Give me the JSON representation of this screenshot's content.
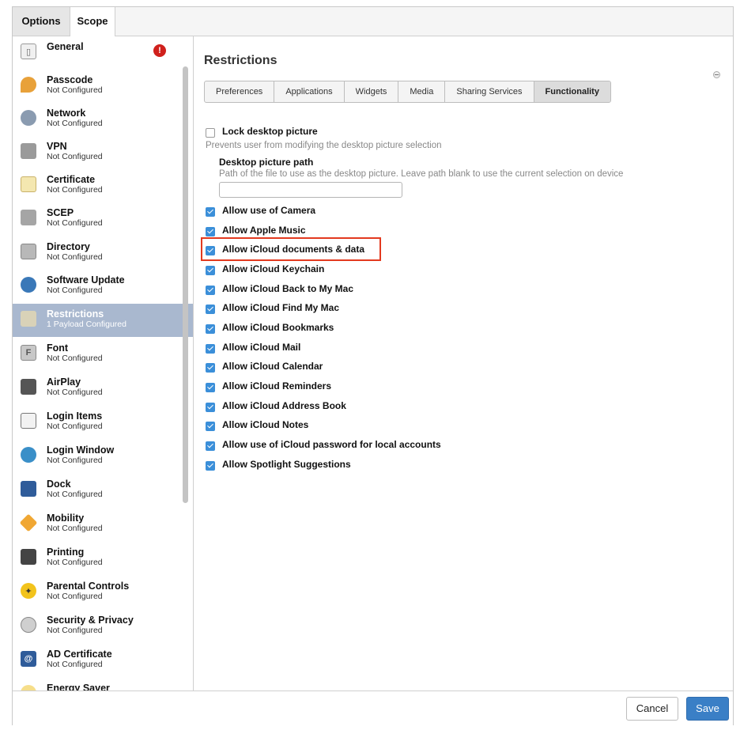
{
  "tabs": {
    "options": "Options",
    "scope": "Scope"
  },
  "sidebar": {
    "error_badge": "!",
    "items": [
      {
        "title": "General",
        "subtitle": "",
        "icon": "general-icon"
      },
      {
        "title": "Passcode",
        "subtitle": "Not Configured",
        "icon": "key-icon"
      },
      {
        "title": "Network",
        "subtitle": "Not Configured",
        "icon": "globe-icon"
      },
      {
        "title": "VPN",
        "subtitle": "Not Configured",
        "icon": "vpn-lock-icon"
      },
      {
        "title": "Certificate",
        "subtitle": "Not Configured",
        "icon": "certificate-icon"
      },
      {
        "title": "SCEP",
        "subtitle": "Not Configured",
        "icon": "scep-lock-icon"
      },
      {
        "title": "Directory",
        "subtitle": "Not Configured",
        "icon": "directory-icon"
      },
      {
        "title": "Software Update",
        "subtitle": "Not Configured",
        "icon": "software-update-icon"
      },
      {
        "title": "Restrictions",
        "subtitle": "1 Payload Configured",
        "icon": "restrictions-icon"
      },
      {
        "title": "Font",
        "subtitle": "Not Configured",
        "icon": "font-icon"
      },
      {
        "title": "AirPlay",
        "subtitle": "Not Configured",
        "icon": "airplay-icon"
      },
      {
        "title": "Login Items",
        "subtitle": "Not Configured",
        "icon": "login-items-icon"
      },
      {
        "title": "Login Window",
        "subtitle": "Not Configured",
        "icon": "login-window-icon"
      },
      {
        "title": "Dock",
        "subtitle": "Not Configured",
        "icon": "dock-icon"
      },
      {
        "title": "Mobility",
        "subtitle": "Not Configured",
        "icon": "mobility-icon"
      },
      {
        "title": "Printing",
        "subtitle": "Not Configured",
        "icon": "printer-icon"
      },
      {
        "title": "Parental Controls",
        "subtitle": "Not Configured",
        "icon": "parental-controls-icon"
      },
      {
        "title": "Security & Privacy",
        "subtitle": "Not Configured",
        "icon": "security-icon"
      },
      {
        "title": "AD Certificate",
        "subtitle": "Not Configured",
        "icon": "ad-certificate-icon"
      },
      {
        "title": "Energy Saver",
        "subtitle": "",
        "icon": "energy-saver-icon"
      }
    ]
  },
  "content": {
    "title": "Restrictions",
    "subtabs": [
      "Preferences",
      "Applications",
      "Widgets",
      "Media",
      "Sharing Services",
      "Functionality"
    ],
    "active_subtab": "Functionality",
    "lock_desktop": {
      "label": "Lock desktop picture",
      "checked": false,
      "description": "Prevents user from modifying the desktop picture selection"
    },
    "desktop_path": {
      "label": "Desktop picture path",
      "description": "Path of the file to use as the desktop picture. Leave path blank to use the current selection on device",
      "value": ""
    },
    "options": [
      "Allow use of Camera",
      "Allow Apple Music",
      "Allow iCloud documents & data",
      "Allow iCloud Keychain",
      "Allow iCloud Back to My Mac",
      "Allow iCloud Find My Mac",
      "Allow iCloud Bookmarks",
      "Allow iCloud Mail",
      "Allow iCloud Calendar",
      "Allow iCloud Reminders",
      "Allow iCloud Address Book",
      "Allow iCloud Notes",
      "Allow use of iCloud password for local accounts",
      "Allow Spotlight Suggestions"
    ]
  },
  "footer": {
    "cancel": "Cancel",
    "save": "Save"
  },
  "colors": {
    "accent": "#3a7fc6",
    "selected": "#a9b8cf",
    "highlight": "#e33a1f",
    "error": "#d0201c"
  }
}
